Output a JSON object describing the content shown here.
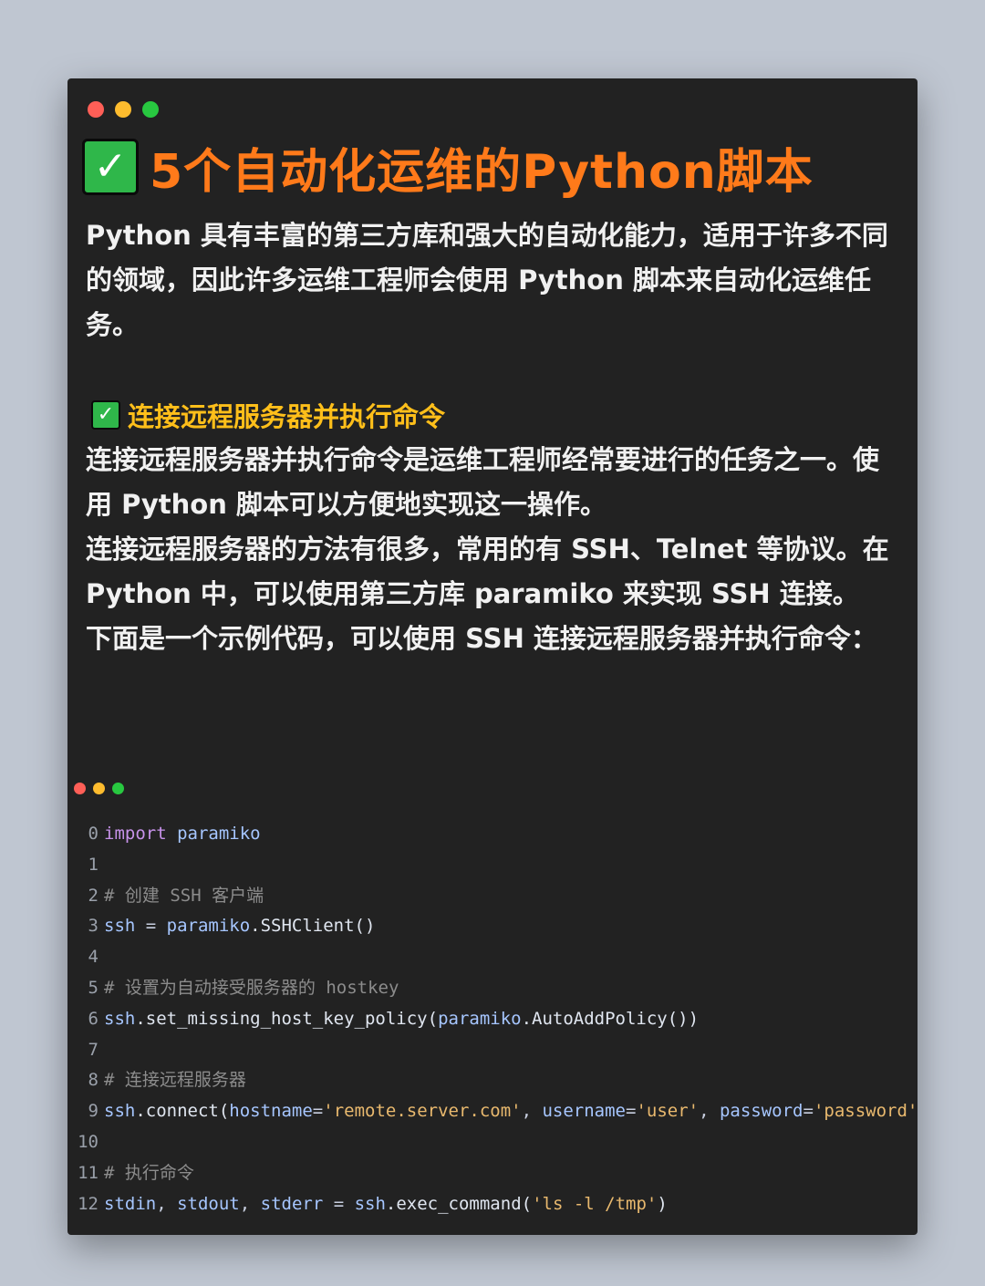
{
  "window": {
    "title": "5个自动化运维的Python脚本",
    "title_icon": "check-mark-icon"
  },
  "intro": "Python 具有丰富的第三方库和强大的自动化能力，适用于许多不同的领域，因此许多运维工程师会使用 Python 脚本来自动化运维任务。",
  "section": {
    "icon": "check-mark-icon",
    "title": "连接远程服务器并执行命令",
    "paragraphs": [
      "连接远程服务器并执行命令是运维工程师经常要进行的任务之一。使用 Python 脚本可以方便地实现这一操作。",
      "连接远程服务器的方法有很多，常用的有 SSH、Telnet 等协议。在 Python 中，可以使用第三方库 paramiko 来实现 SSH 连接。",
      "下面是一个示例代码，可以使用 SSH 连接远程服务器并执行命令："
    ]
  },
  "code": {
    "line_numbers": [
      "0",
      "1",
      "2",
      "3",
      "4",
      "5",
      "6",
      "7",
      "8",
      "9",
      "10",
      "11",
      "12"
    ],
    "lines": [
      [
        {
          "t": "import",
          "c": "kw"
        },
        {
          "t": " ",
          "c": "punc"
        },
        {
          "t": "paramiko",
          "c": "id"
        }
      ],
      [],
      [
        {
          "t": "# 创建 SSH 客户端",
          "c": "com"
        }
      ],
      [
        {
          "t": "ssh",
          "c": "id"
        },
        {
          "t": " = ",
          "c": "punc"
        },
        {
          "t": "paramiko",
          "c": "id"
        },
        {
          "t": ".SSHClient()",
          "c": "fn"
        }
      ],
      [],
      [
        {
          "t": "# 设置为自动接受服务器的 hostkey",
          "c": "com"
        }
      ],
      [
        {
          "t": "ssh",
          "c": "id"
        },
        {
          "t": ".set_missing_host_key_policy(",
          "c": "fn"
        },
        {
          "t": "paramiko",
          "c": "id"
        },
        {
          "t": ".AutoAddPolicy())",
          "c": "fn"
        }
      ],
      [],
      [
        {
          "t": "# 连接远程服务器",
          "c": "com"
        }
      ],
      [
        {
          "t": "ssh",
          "c": "id"
        },
        {
          "t": ".connect(",
          "c": "fn"
        },
        {
          "t": "hostname",
          "c": "id"
        },
        {
          "t": "=",
          "c": "punc"
        },
        {
          "t": "'remote.server.com'",
          "c": "str"
        },
        {
          "t": ", ",
          "c": "punc"
        },
        {
          "t": "username",
          "c": "id"
        },
        {
          "t": "=",
          "c": "punc"
        },
        {
          "t": "'user'",
          "c": "str"
        },
        {
          "t": ", ",
          "c": "punc"
        },
        {
          "t": "password",
          "c": "id"
        },
        {
          "t": "=",
          "c": "punc"
        },
        {
          "t": "'password'",
          "c": "str"
        },
        {
          "t": ")",
          "c": "fn"
        }
      ],
      [],
      [
        {
          "t": "# 执行命令",
          "c": "com"
        }
      ],
      [
        {
          "t": "stdin",
          "c": "id"
        },
        {
          "t": ", ",
          "c": "punc"
        },
        {
          "t": "stdout",
          "c": "id"
        },
        {
          "t": ", ",
          "c": "punc"
        },
        {
          "t": "stderr",
          "c": "id"
        },
        {
          "t": " = ",
          "c": "punc"
        },
        {
          "t": "ssh",
          "c": "id"
        },
        {
          "t": ".exec_command(",
          "c": "fn"
        },
        {
          "t": "'ls -l /tmp'",
          "c": "str"
        },
        {
          "t": ")",
          "c": "fn"
        }
      ]
    ]
  },
  "colors": {
    "title": "#ff7a1a",
    "section_title": "#ffbf1a",
    "background": "#222222",
    "page": "#bfc6d1"
  }
}
